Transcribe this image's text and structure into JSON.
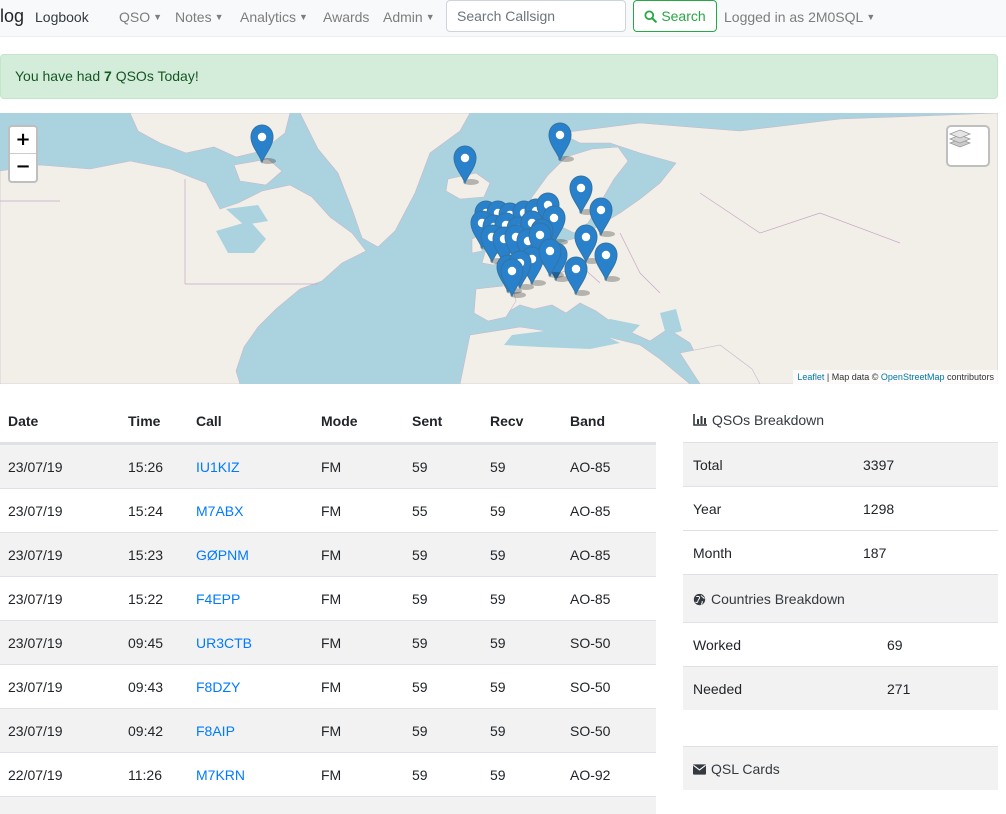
{
  "nav": {
    "brand": "log",
    "items": [
      {
        "label": "Logbook",
        "dropdown": false,
        "active": true
      },
      {
        "label": "QSO",
        "dropdown": true,
        "active": false
      },
      {
        "label": "Notes",
        "dropdown": true,
        "active": false
      },
      {
        "label": "Analytics",
        "dropdown": true,
        "active": false
      },
      {
        "label": "Awards",
        "dropdown": false,
        "active": false
      },
      {
        "label": "Admin",
        "dropdown": true,
        "active": false
      }
    ],
    "search_placeholder": "Search Callsign",
    "search_button": "Search",
    "user_label": "Logged in as 2M0SQL"
  },
  "alert": {
    "prefix": "You have had ",
    "count": "7",
    "suffix": " QSOs Today!"
  },
  "map": {
    "zoom_in": "+",
    "zoom_out": "−",
    "attribution_leaflet": "Leaflet",
    "attribution_mid": " | Map data © ",
    "attribution_osm": "OpenStreetMap",
    "attribution_end": " contributors",
    "marker_color": "#2a81cb"
  },
  "qso_table": {
    "headers": [
      "Date",
      "Time",
      "Call",
      "Mode",
      "Sent",
      "Recv",
      "Band"
    ],
    "rows": [
      {
        "date": "23/07/19",
        "time": "15:26",
        "call": "IU1KIZ",
        "mode": "FM",
        "sent": "59",
        "recv": "59",
        "band": "AO-85"
      },
      {
        "date": "23/07/19",
        "time": "15:24",
        "call": "M7ABX",
        "mode": "FM",
        "sent": "55",
        "recv": "59",
        "band": "AO-85"
      },
      {
        "date": "23/07/19",
        "time": "15:23",
        "call": "GØPNM",
        "mode": "FM",
        "sent": "59",
        "recv": "59",
        "band": "AO-85"
      },
      {
        "date": "23/07/19",
        "time": "15:22",
        "call": "F4EPP",
        "mode": "FM",
        "sent": "59",
        "recv": "59",
        "band": "AO-85"
      },
      {
        "date": "23/07/19",
        "time": "09:45",
        "call": "UR3CTB",
        "mode": "FM",
        "sent": "59",
        "recv": "59",
        "band": "SO-50"
      },
      {
        "date": "23/07/19",
        "time": "09:43",
        "call": "F8DZY",
        "mode": "FM",
        "sent": "59",
        "recv": "59",
        "band": "SO-50"
      },
      {
        "date": "23/07/19",
        "time": "09:42",
        "call": "F8AIP",
        "mode": "FM",
        "sent": "59",
        "recv": "59",
        "band": "SO-50"
      },
      {
        "date": "22/07/19",
        "time": "11:26",
        "call": "M7KRN",
        "mode": "FM",
        "sent": "59",
        "recv": "59",
        "band": "AO-92"
      }
    ]
  },
  "qsos_breakdown": {
    "title": "QSOs Breakdown",
    "rows": [
      {
        "label": "Total",
        "value": "3397"
      },
      {
        "label": "Year",
        "value": "1298"
      },
      {
        "label": "Month",
        "value": "187"
      }
    ]
  },
  "countries_breakdown": {
    "title": "Countries Breakdown",
    "rows": [
      {
        "label": "Worked",
        "value": "69"
      },
      {
        "label": "Needed",
        "value": "271"
      }
    ]
  },
  "qsl_cards": {
    "title": "QSL Cards"
  }
}
